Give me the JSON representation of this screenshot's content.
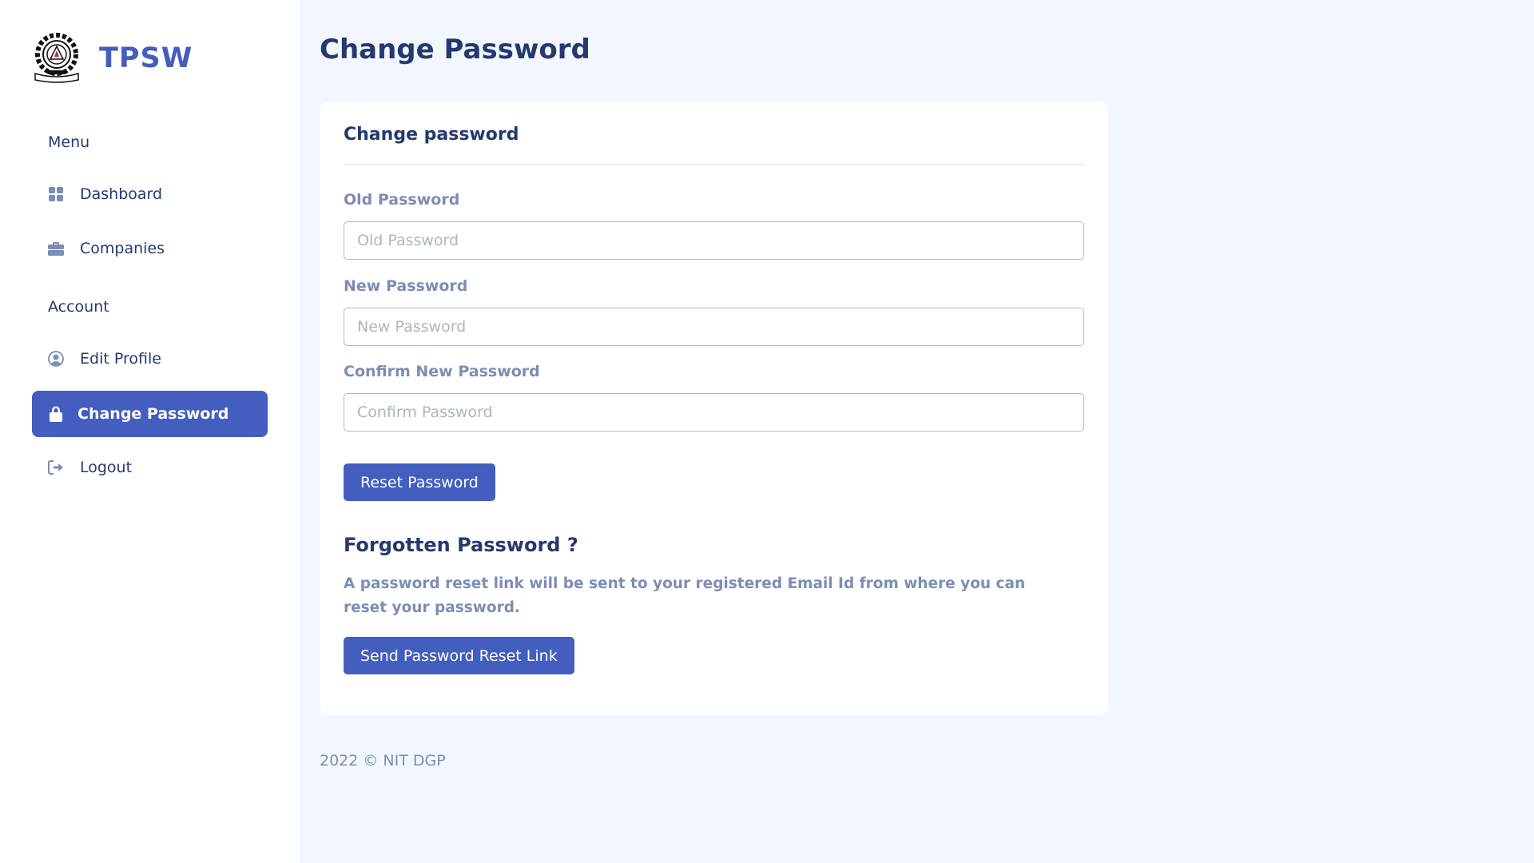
{
  "app": {
    "brand": "TPSW",
    "accent_color": "#435ebe"
  },
  "sidebar": {
    "sections": [
      {
        "title": "Menu",
        "items": [
          {
            "label": "Dashboard",
            "icon": "grid-icon",
            "active": false
          },
          {
            "label": "Companies",
            "icon": "briefcase-icon",
            "active": false
          }
        ]
      },
      {
        "title": "Account",
        "items": [
          {
            "label": "Edit Profile",
            "icon": "user-circle-icon",
            "active": false
          },
          {
            "label": "Change Password",
            "icon": "lock-icon",
            "active": true
          },
          {
            "label": "Logout",
            "icon": "logout-icon",
            "active": false
          }
        ]
      }
    ]
  },
  "main": {
    "page_title": "Change Password",
    "card": {
      "title": "Change password",
      "fields": [
        {
          "label": "Old Password",
          "placeholder": "Old Password",
          "value": ""
        },
        {
          "label": "New Password",
          "placeholder": "New Password",
          "value": ""
        },
        {
          "label": "Confirm New Password",
          "placeholder": "Confirm Password",
          "value": ""
        }
      ],
      "reset_button": "Reset Password",
      "forgot": {
        "title": "Forgotten Password ?",
        "text": "A password reset link will be sent to your registered Email Id from where you can reset your password.",
        "button": "Send Password Reset Link"
      }
    },
    "footer": "2022 © NIT DGP"
  }
}
